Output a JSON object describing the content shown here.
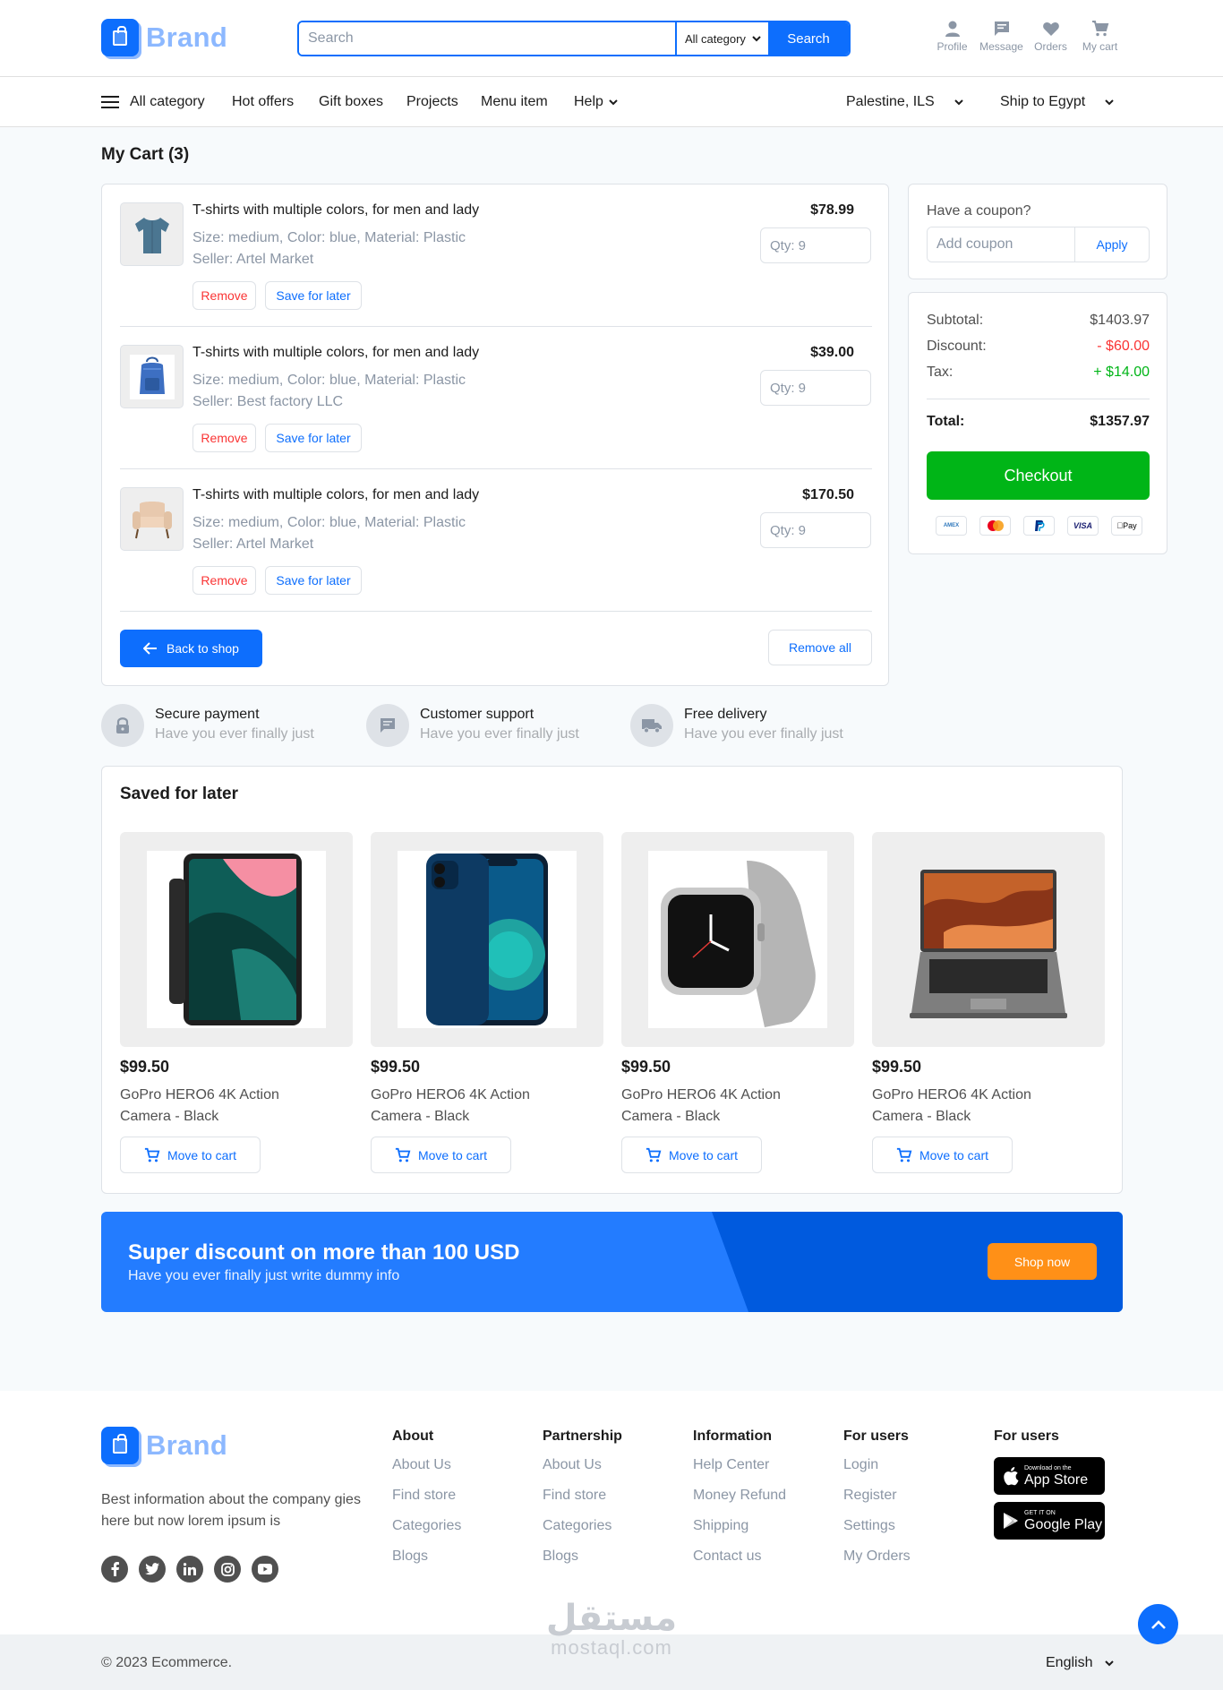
{
  "brand": {
    "name": "Brand"
  },
  "search": {
    "placeholder": "Search",
    "category": "All category",
    "button": "Search"
  },
  "actions": [
    {
      "icon": "user-icon",
      "label": "Profile"
    },
    {
      "icon": "message-icon",
      "label": "Message"
    },
    {
      "icon": "heart-icon",
      "label": "Orders"
    },
    {
      "icon": "cart-icon",
      "label": "My cart"
    }
  ],
  "nav": {
    "items": [
      "All category",
      "Hot offers",
      "Gift boxes",
      "Projects",
      "Menu item",
      "Help"
    ],
    "region": "Palestine, ILS",
    "ship": "Ship to Egypt"
  },
  "page_title": "My Cart (3)",
  "cart": {
    "items": [
      {
        "title": "T-shirts with multiple colors, for men and lady",
        "attrs": "Size: medium, Color: blue, Material: Plastic",
        "seller": "Seller: Artel Market",
        "price": "$78.99",
        "qty": "Qty: 9",
        "image": "shirt"
      },
      {
        "title": "T-shirts with multiple colors, for men and lady",
        "attrs": "Size: medium, Color: blue, Material: Plastic",
        "seller": "Seller: Best factory LLC",
        "price": "$39.00",
        "qty": "Qty: 9",
        "image": "backpack"
      },
      {
        "title": "T-shirts with multiple colors, for men and lady",
        "attrs": "Size: medium, Color: blue, Material: Plastic",
        "seller": "Seller: Artel Market",
        "price": "$170.50",
        "qty": "Qty: 9",
        "image": "armchair"
      }
    ],
    "remove_label": "Remove",
    "save_label": "Save for later",
    "back_label": "Back to shop",
    "remove_all_label": "Remove all"
  },
  "coupon": {
    "label": "Have a coupon?",
    "placeholder": "Add coupon",
    "apply": "Apply"
  },
  "summary": {
    "subtotal_label": "Subtotal:",
    "subtotal": "$1403.97",
    "discount_label": "Discount:",
    "discount": "- $60.00",
    "tax_label": "Tax:",
    "tax": "+ $14.00",
    "total_label": "Total:",
    "total": "$1357.97",
    "checkout": "Checkout",
    "payments": [
      "AMEX",
      "MC",
      "PayPal",
      "VISA",
      "Apple Pay"
    ]
  },
  "features": [
    {
      "title": "Secure payment",
      "sub": "Have you ever finally just",
      "icon": "lock-icon"
    },
    {
      "title": "Customer support",
      "sub": "Have you ever finally just",
      "icon": "message-icon"
    },
    {
      "title": "Free delivery",
      "sub": "Have you ever finally just",
      "icon": "truck-icon"
    }
  ],
  "saved": {
    "title": "Saved for later",
    "move_label": "Move to cart",
    "products": [
      {
        "price": "$99.50",
        "name": "GoPro HERO6 4K Action Camera - Black",
        "image": "tablet"
      },
      {
        "price": "$99.50",
        "name": "GoPro HERO6 4K Action Camera - Black",
        "image": "phone"
      },
      {
        "price": "$99.50",
        "name": "GoPro HERO6 4K Action Camera - Black",
        "image": "smartwatch"
      },
      {
        "price": "$99.50",
        "name": "GoPro HERO6 4K Action Camera - Black",
        "image": "laptop"
      }
    ]
  },
  "banner": {
    "title": "Super discount on more than 100 USD",
    "sub": "Have you ever finally just write dummy info",
    "button": "Shop now"
  },
  "footer": {
    "description": "Best information about the company gies here but now lorem ipsum is",
    "columns": [
      {
        "title": "About",
        "links": [
          "About Us",
          "Find store",
          "Categories",
          "Blogs"
        ]
      },
      {
        "title": "Partnership",
        "links": [
          "About Us",
          "Find store",
          "Categories",
          "Blogs"
        ]
      },
      {
        "title": "Information",
        "links": [
          "Help Center",
          "Money Refund",
          "Shipping",
          "Contact us"
        ]
      },
      {
        "title": "For users",
        "links": [
          "Login",
          "Register",
          "Settings",
          "My Orders"
        ]
      }
    ],
    "apps_title": "For users",
    "app_store": {
      "small": "Download on the",
      "big": "App Store"
    },
    "google_play": {
      "small": "GET IT ON",
      "big": "Google Play"
    },
    "copyright": "© 2023 Ecommerce.",
    "language": "English"
  },
  "watermark": {
    "arabic": "مستقل",
    "latin": "mostaql.com"
  },
  "colors": {
    "primary": "#0d6efd",
    "success": "#00b517",
    "danger": "#fa3434",
    "warning": "#ff9017"
  }
}
